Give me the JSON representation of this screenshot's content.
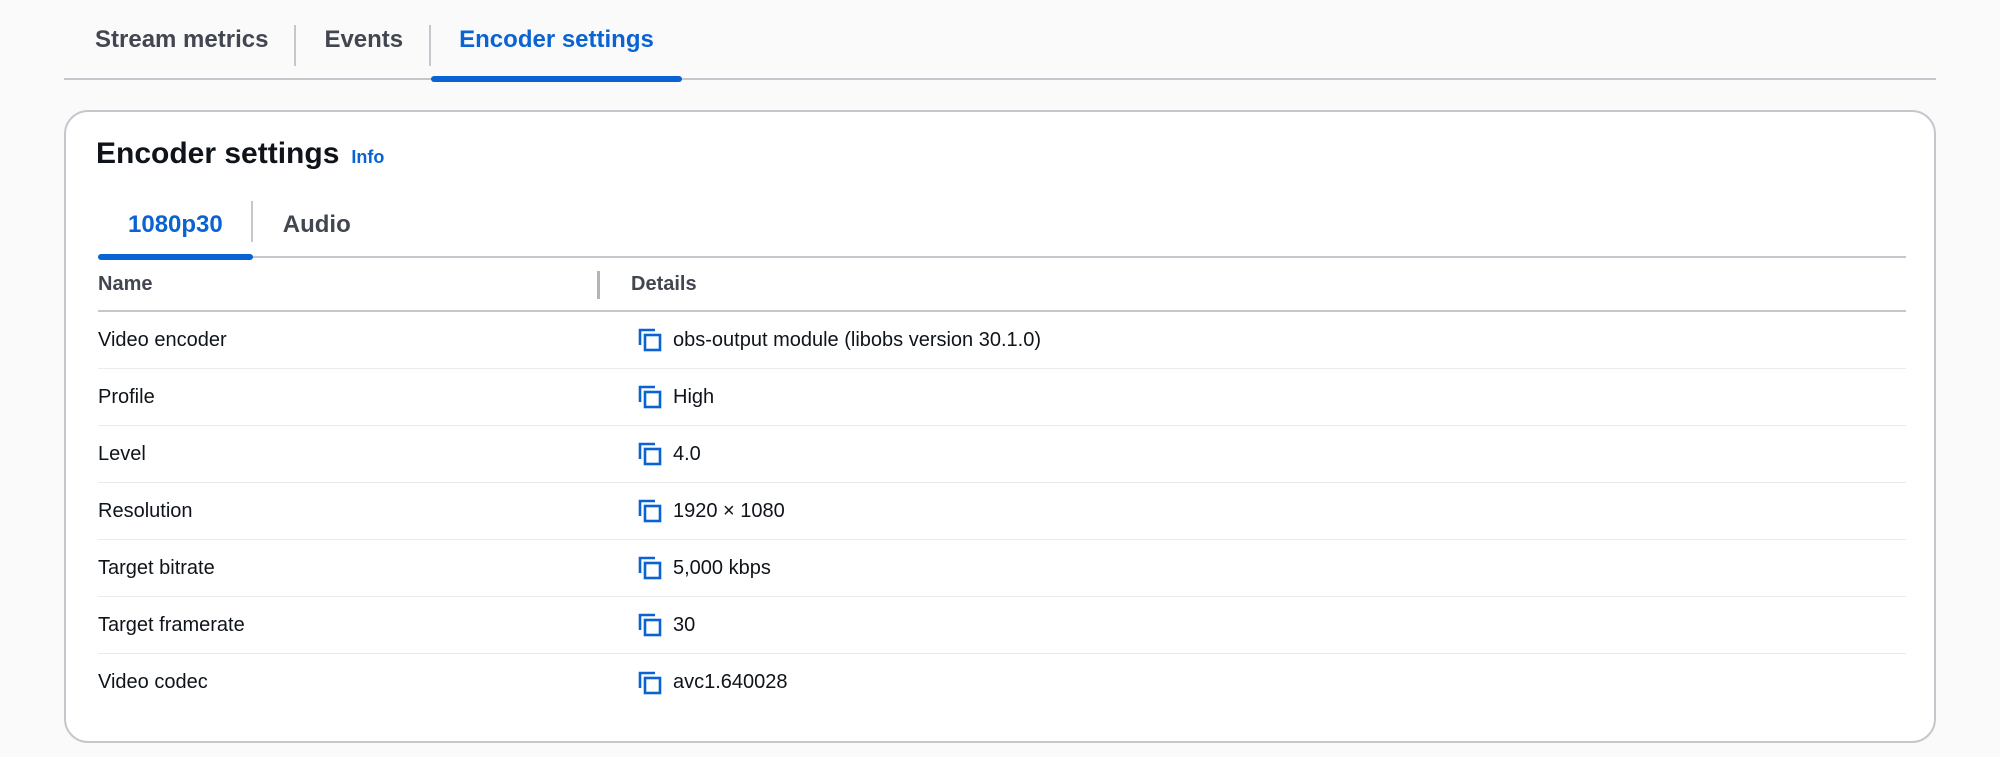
{
  "top_tabs": [
    {
      "label": "Stream metrics",
      "active": false
    },
    {
      "label": "Events",
      "active": false
    },
    {
      "label": "Encoder settings",
      "active": true
    }
  ],
  "card": {
    "title": "Encoder settings",
    "info_label": "Info"
  },
  "inner_tabs": [
    {
      "label": "1080p30",
      "active": true
    },
    {
      "label": "Audio",
      "active": false
    }
  ],
  "table": {
    "columns": {
      "name": "Name",
      "details": "Details"
    },
    "rows": [
      {
        "name": "Video encoder",
        "value": "obs-output module (libobs version 30.1.0)"
      },
      {
        "name": "Profile",
        "value": "High"
      },
      {
        "name": "Level",
        "value": "4.0"
      },
      {
        "name": "Resolution",
        "value": "1920 × 1080"
      },
      {
        "name": "Target bitrate",
        "value": "5,000 kbps"
      },
      {
        "name": "Target framerate",
        "value": "30"
      },
      {
        "name": "Video codec",
        "value": "avc1.640028"
      }
    ]
  },
  "icons": {
    "copy": "copy-icon"
  },
  "colors": {
    "accent": "#0a63d2",
    "border": "#c6c6cd",
    "text": "#0f141a",
    "muted": "#424650"
  }
}
